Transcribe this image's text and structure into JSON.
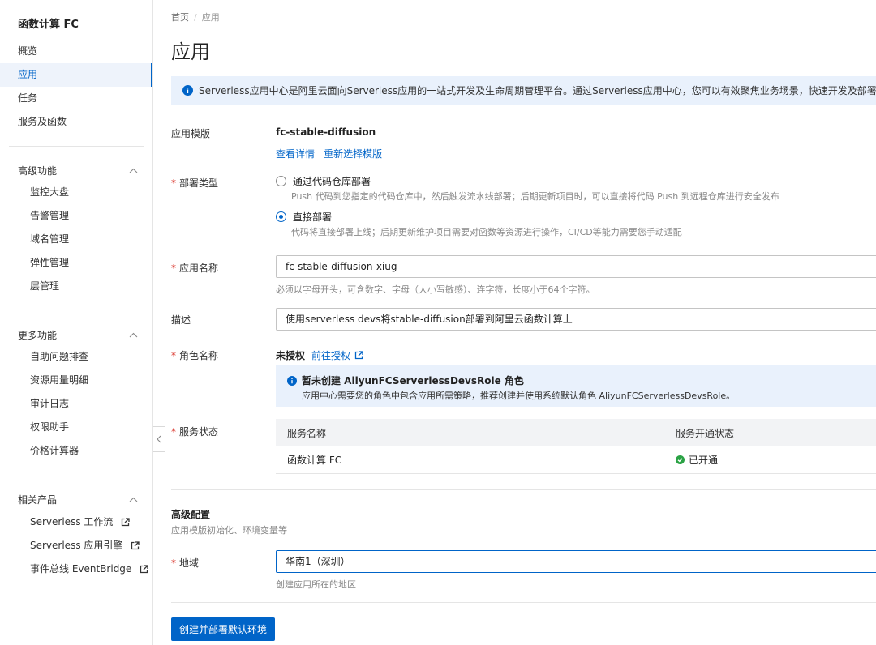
{
  "sidebar": {
    "brand": "函数计算 FC",
    "items": [
      {
        "label": "概览"
      },
      {
        "label": "应用"
      },
      {
        "label": "任务"
      },
      {
        "label": "服务及函数"
      }
    ],
    "groups": [
      {
        "title": "高级功能",
        "items": [
          {
            "label": "监控大盘"
          },
          {
            "label": "告警管理"
          },
          {
            "label": "域名管理"
          },
          {
            "label": "弹性管理"
          },
          {
            "label": "层管理"
          }
        ]
      },
      {
        "title": "更多功能",
        "items": [
          {
            "label": "自助问题排查"
          },
          {
            "label": "资源用量明细"
          },
          {
            "label": "审计日志"
          },
          {
            "label": "权限助手"
          },
          {
            "label": "价格计算器"
          }
        ]
      },
      {
        "title": "相关产品",
        "items": [
          {
            "label": "Serverless 工作流"
          },
          {
            "label": "Serverless 应用引擎"
          },
          {
            "label": "事件总线 EventBridge"
          }
        ]
      }
    ]
  },
  "breadcrumb": {
    "home": "首页",
    "current": "应用"
  },
  "page_title": "应用",
  "info_banner": "Serverless应用中心是阿里云面向Serverless应用的一站式开发及生命周期管理平台。通过Serverless应用中心，您可以有效聚焦业务场景，快速开发及部署Serverless应用、",
  "form": {
    "template": {
      "label": "应用模版",
      "value": "fc-stable-diffusion",
      "link_details": "查看详情",
      "link_reselect": "重新选择模版"
    },
    "deploy_type": {
      "label": "部署类型",
      "options": [
        {
          "label": "通过代码仓库部署",
          "desc": "Push 代码到您指定的代码仓库中，然后触发流水线部署；后期更新项目时，可以直接将代码 Push 到远程仓库进行安全发布"
        },
        {
          "label": "直接部署",
          "desc": "代码将直接部署上线；后期更新维护项目需要对函数等资源进行操作，CI/CD等能力需要您手动适配"
        }
      ],
      "selected": "直接部署"
    },
    "app_name": {
      "label": "应用名称",
      "value": "fc-stable-diffusion-xiug",
      "help": "必须以字母开头，可含数字、字母（大小写敏感）、连字符，长度小于64个字符。"
    },
    "description": {
      "label": "描述",
      "value": "使用serverless devs将stable-diffusion部署到阿里云函数计算上"
    },
    "role": {
      "label": "角色名称",
      "status": "未授权",
      "link": "前往授权",
      "notice_title": "暂未创建 AliyunFCServerlessDevsRole 角色",
      "notice_body": "应用中心需要您的角色中包含应用所需策略，推荐创建并使用系统默认角色 AliyunFCServerlessDevsRole。"
    },
    "service_status": {
      "label": "服务状态",
      "columns": [
        "服务名称",
        "服务开通状态"
      ],
      "rows": [
        {
          "name": "函数计算 FC",
          "status": "已开通"
        }
      ]
    }
  },
  "advanced": {
    "title": "高级配置",
    "subtitle": "应用模版初始化、环境变量等",
    "region": {
      "label": "地域",
      "value": "华南1（深圳）",
      "help": "创建应用所在的地区"
    }
  },
  "submit_label": "创建并部署默认环境",
  "colors": {
    "accent": "#0064c8",
    "success": "#2aa244",
    "required": "#d93026"
  }
}
